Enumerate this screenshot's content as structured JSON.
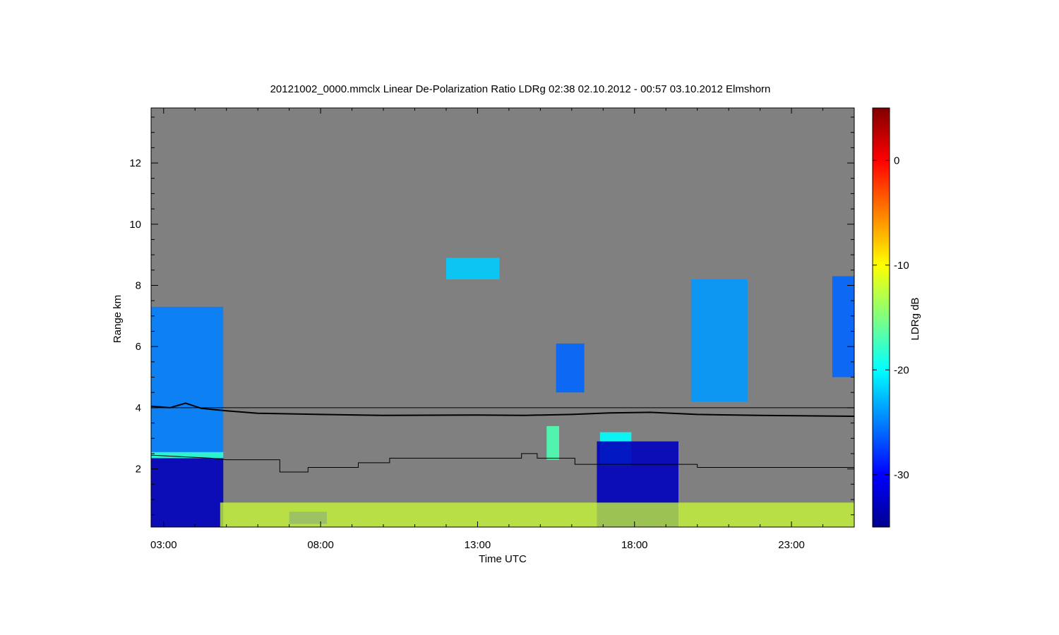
{
  "chart_data": {
    "type": "heatmap",
    "title": "20121002_0000.mmclx Linear De-Polarization Ratio LDRg   02:38 02.10.2012 - 00:57 03.10.2012 Elmshorn",
    "xlabel": "Time UTC",
    "ylabel": "Range km",
    "colorbar_label": "LDRg dB",
    "x_unit": "hours UTC",
    "xlim": [
      2.6,
      25.0
    ],
    "ylim": [
      0.1,
      13.8
    ],
    "x_ticks": [
      {
        "value": 3,
        "label": "03:00"
      },
      {
        "value": 8,
        "label": "08:00"
      },
      {
        "value": 13,
        "label": "13:00"
      },
      {
        "value": 18,
        "label": "18:00"
      },
      {
        "value": 23,
        "label": "23:00"
      }
    ],
    "y_ticks": [
      {
        "value": 2,
        "label": "2"
      },
      {
        "value": 4,
        "label": "4"
      },
      {
        "value": 6,
        "label": "6"
      },
      {
        "value": 8,
        "label": "8"
      },
      {
        "value": 10,
        "label": "10"
      },
      {
        "value": 12,
        "label": "12"
      }
    ],
    "colorbar_range": [
      -35,
      5
    ],
    "colorbar_ticks": [
      {
        "value": 0,
        "label": "0"
      },
      {
        "value": -10,
        "label": "-10"
      },
      {
        "value": -20,
        "label": "-20"
      },
      {
        "value": -30,
        "label": "-30"
      }
    ],
    "background_color": "#808080",
    "colormap": [
      "#00008f",
      "#0000ff",
      "#0080ff",
      "#00ffff",
      "#80ff80",
      "#ffff00",
      "#ff8000",
      "#ff0000",
      "#800000"
    ],
    "lines": [
      {
        "id": "upper-level-line",
        "color": "#000000",
        "points": [
          [
            2.6,
            4.0
          ],
          [
            25.0,
            4.0
          ]
        ]
      },
      {
        "id": "noisy-height-line",
        "color": "#000000",
        "points": [
          [
            2.6,
            4.05
          ],
          [
            3.2,
            4.0
          ],
          [
            3.7,
            4.15
          ],
          [
            4.2,
            3.98
          ],
          [
            5.0,
            3.9
          ],
          [
            6.0,
            3.82
          ],
          [
            8.0,
            3.78
          ],
          [
            10.0,
            3.75
          ],
          [
            13.0,
            3.76
          ],
          [
            14.5,
            3.75
          ],
          [
            16.0,
            3.78
          ],
          [
            17.2,
            3.83
          ],
          [
            18.5,
            3.85
          ],
          [
            20.0,
            3.78
          ],
          [
            22.0,
            3.75
          ],
          [
            25.0,
            3.72
          ]
        ]
      },
      {
        "id": "step-height-line",
        "color": "#000000",
        "points": [
          [
            2.6,
            2.45
          ],
          [
            4.5,
            2.35
          ],
          [
            5.0,
            2.3
          ],
          [
            6.7,
            2.3
          ],
          [
            6.7,
            1.9
          ],
          [
            7.6,
            1.9
          ],
          [
            7.6,
            2.05
          ],
          [
            9.2,
            2.05
          ],
          [
            9.2,
            2.2
          ],
          [
            10.2,
            2.2
          ],
          [
            10.2,
            2.35
          ],
          [
            14.4,
            2.35
          ],
          [
            14.4,
            2.5
          ],
          [
            14.9,
            2.5
          ],
          [
            14.9,
            2.35
          ],
          [
            16.1,
            2.35
          ],
          [
            16.1,
            2.15
          ],
          [
            20.0,
            2.15
          ],
          [
            20.0,
            2.05
          ],
          [
            25.0,
            2.05
          ]
        ]
      }
    ],
    "echo_regions": [
      {
        "x": [
          2.6,
          4.9
        ],
        "y": [
          2.4,
          7.3
        ],
        "ldr": -25
      },
      {
        "x": [
          2.6,
          4.9
        ],
        "y": [
          0.1,
          2.4
        ],
        "ldr": -33
      },
      {
        "x": [
          2.6,
          4.9
        ],
        "y": [
          2.35,
          2.55
        ],
        "ldr": -18
      },
      {
        "x": [
          7.0,
          8.2
        ],
        "y": [
          0.2,
          0.6
        ],
        "ldr": -30
      },
      {
        "x": [
          12.0,
          13.7
        ],
        "y": [
          8.2,
          8.9
        ],
        "ldr": -22
      },
      {
        "x": [
          15.5,
          16.4
        ],
        "y": [
          4.5,
          6.1
        ],
        "ldr": -26
      },
      {
        "x": [
          15.2,
          15.6
        ],
        "y": [
          2.3,
          3.4
        ],
        "ldr": -17
      },
      {
        "x": [
          16.9,
          17.9
        ],
        "y": [
          2.1,
          3.2
        ],
        "ldr": -20
      },
      {
        "x": [
          16.8,
          19.4
        ],
        "y": [
          0.1,
          2.9
        ],
        "ldr": -33
      },
      {
        "x": [
          19.8,
          21.6
        ],
        "y": [
          4.2,
          8.2
        ],
        "ldr": -24
      },
      {
        "x": [
          24.3,
          25.0
        ],
        "y": [
          5.0,
          8.3
        ],
        "ldr": -26
      },
      {
        "x": [
          4.8,
          25.0
        ],
        "y": [
          0.1,
          0.9
        ],
        "ldr": -12
      }
    ]
  }
}
